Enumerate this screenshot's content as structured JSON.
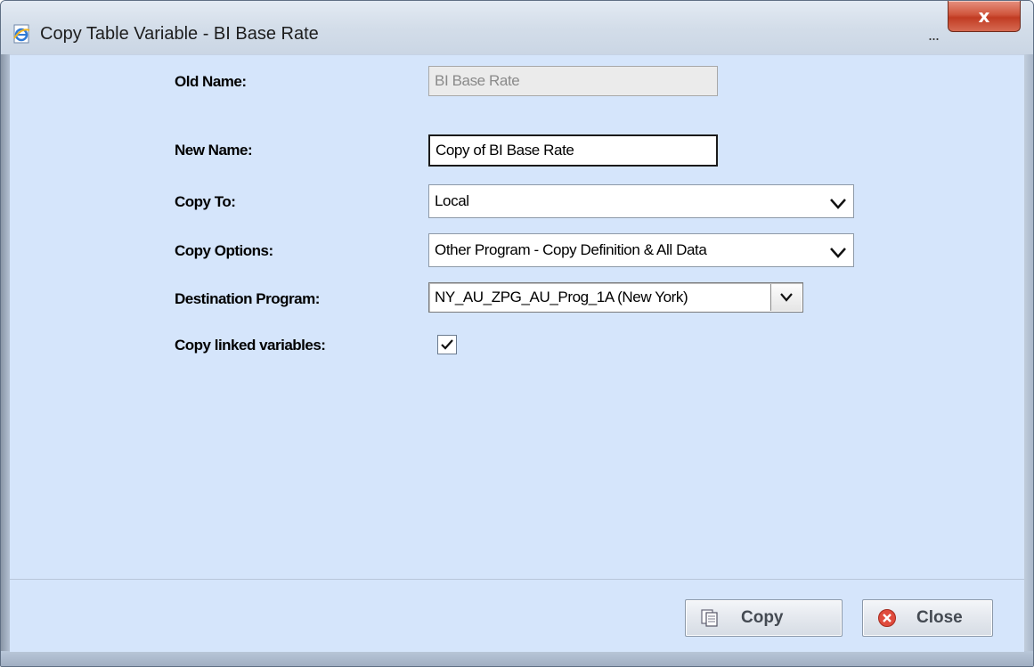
{
  "window": {
    "title": "Copy Table Variable - BI Base Rate",
    "ellipsis": "...",
    "close_glyph": "x"
  },
  "form": {
    "old_name": {
      "label": "Old Name:",
      "value": "BI Base Rate"
    },
    "new_name": {
      "label": "New Name:",
      "value": "Copy of BI Base Rate"
    },
    "copy_to": {
      "label": "Copy To:",
      "value": "Local"
    },
    "copy_options": {
      "label": "Copy Options:",
      "value": "Other Program - Copy Definition & All Data"
    },
    "destination_program": {
      "label": "Destination Program:",
      "value": "NY_AU_ZPG_AU_Prog_1A (New York)"
    },
    "copy_linked_variables": {
      "label": "Copy linked variables:",
      "checked": true
    }
  },
  "buttons": {
    "copy_label": "Copy",
    "close_label": "Close"
  },
  "colors": {
    "content_bg": "#d5e5fb",
    "titlebar_bg": "#d3dde9",
    "close_button": "#c13b22"
  },
  "icons": {
    "title": "ie-page-icon",
    "copy": "copy-pages-icon",
    "close": "red-x-circle-icon",
    "dropdown": "chevron-down-icon",
    "checkbox": "checkmark-icon"
  }
}
